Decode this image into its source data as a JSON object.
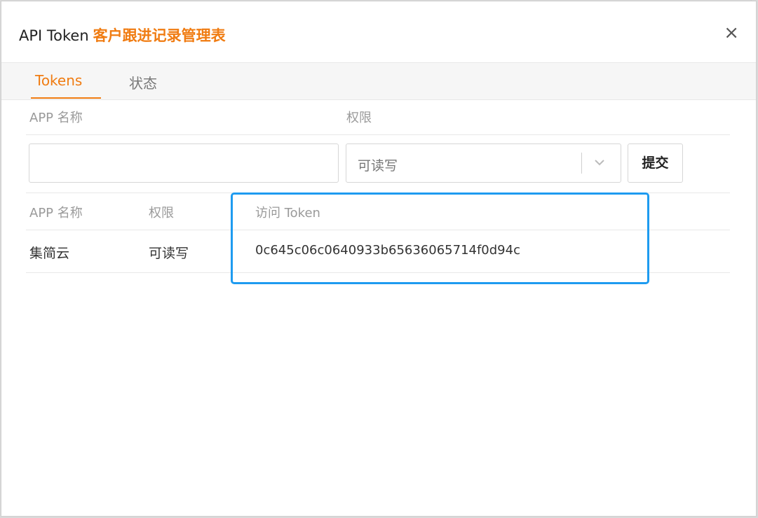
{
  "dialog": {
    "title_prefix": "API Token",
    "title_app": "客户跟进记录管理表",
    "close_label": "×"
  },
  "tabs": [
    {
      "label": "Tokens",
      "active": true
    },
    {
      "label": "状态",
      "active": false
    }
  ],
  "form": {
    "app_name_label": "APP 名称",
    "permission_label": "权限",
    "app_name_value": "",
    "permission_selected": "可读写",
    "submit_label": "提交"
  },
  "table": {
    "columns": [
      "APP 名称",
      "权限",
      "访问 Token"
    ],
    "rows": [
      {
        "app_name": "集简云",
        "permission": "可读写",
        "token": "0c645c06c0640933b65636065714f0d94c"
      }
    ]
  },
  "colors": {
    "accent": "#f07c12",
    "highlight": "#1e9bf0"
  }
}
